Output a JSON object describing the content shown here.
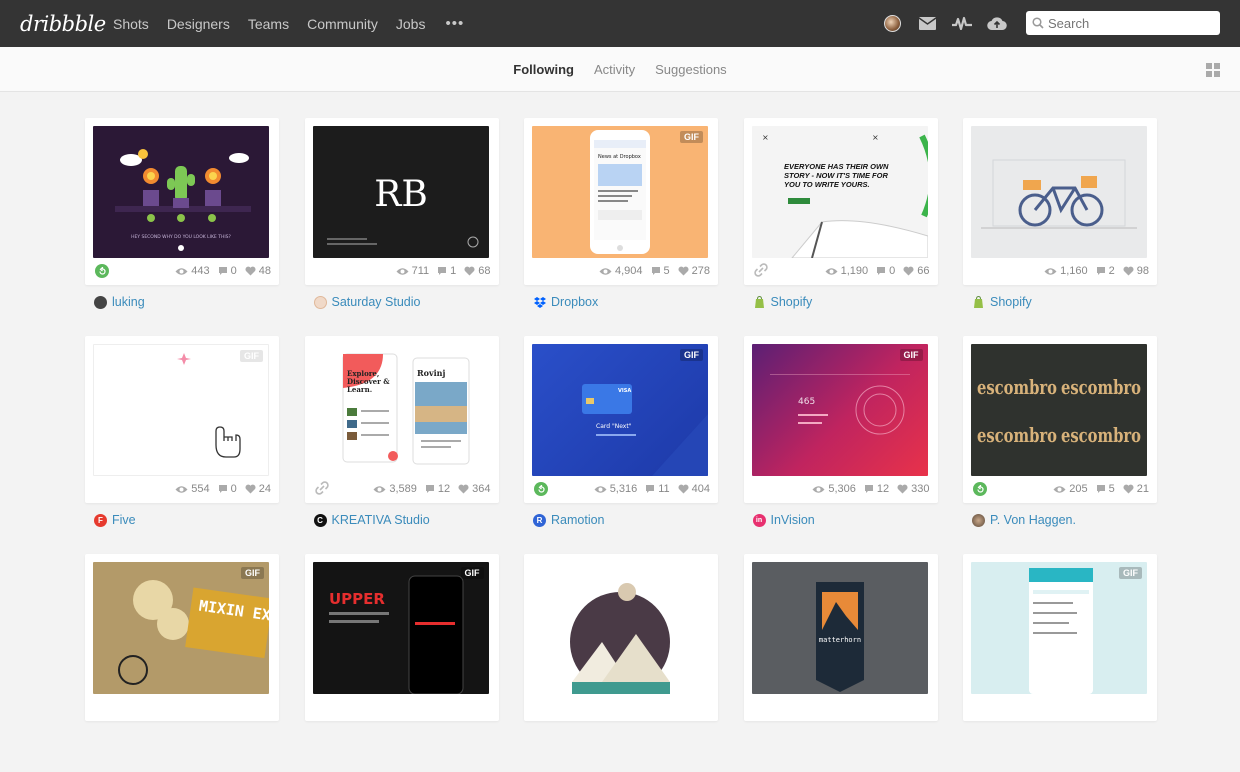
{
  "nav": {
    "logo": "dribbble",
    "links": [
      "Shots",
      "Designers",
      "Teams",
      "Community",
      "Jobs"
    ],
    "more": "•••",
    "search_placeholder": "Search"
  },
  "subnav": {
    "tabs": [
      "Following",
      "Activity",
      "Suggestions"
    ],
    "active": "Following"
  },
  "shots": [
    {
      "owner": "luking",
      "views": "443",
      "comments": "0",
      "likes": "48",
      "gif": false,
      "lead": "rebound",
      "accent": "#2b1836"
    },
    {
      "owner": "Saturday Studio",
      "views": "711",
      "comments": "1",
      "likes": "68",
      "gif": false,
      "lead": "none",
      "accent": "#1c1c1c"
    },
    {
      "owner": "Dropbox",
      "views": "4,904",
      "comments": "5",
      "likes": "278",
      "gif": true,
      "lead": "none",
      "accent": "#f9b473"
    },
    {
      "owner": "Shopify",
      "views": "1,190",
      "comments": "0",
      "likes": "66",
      "gif": false,
      "lead": "attachment",
      "accent": "#f4f4f4"
    },
    {
      "owner": "Shopify",
      "views": "1,160",
      "comments": "2",
      "likes": "98",
      "gif": false,
      "lead": "none",
      "accent": "#e9eaeb"
    },
    {
      "owner": "Five",
      "views": "554",
      "comments": "0",
      "likes": "24",
      "gif": true,
      "lead": "none",
      "accent": "#ffffff"
    },
    {
      "owner": "KREATIVA Studio",
      "views": "3,589",
      "comments": "12",
      "likes": "364",
      "gif": false,
      "lead": "attachment",
      "accent": "#ffffff"
    },
    {
      "owner": "Ramotion",
      "views": "5,316",
      "comments": "11",
      "likes": "404",
      "gif": true,
      "lead": "rebound",
      "accent": "#2a4fc9"
    },
    {
      "owner": "InVision",
      "views": "5,306",
      "comments": "12",
      "likes": "330",
      "gif": true,
      "lead": "none",
      "accent": "#c0245f"
    },
    {
      "owner": "P. Von Haggen.",
      "views": "205",
      "comments": "5",
      "likes": "21",
      "gif": false,
      "lead": "rebound",
      "accent": "#2f322e"
    },
    {
      "owner": "",
      "views": "",
      "comments": "",
      "likes": "",
      "gif": true,
      "lead": "none",
      "accent": "#b39a69"
    },
    {
      "owner": "",
      "views": "",
      "comments": "",
      "likes": "",
      "gif": true,
      "lead": "none",
      "accent": "#141414"
    },
    {
      "owner": "",
      "views": "",
      "comments": "",
      "likes": "",
      "gif": false,
      "lead": "none",
      "accent": "#ffffff"
    },
    {
      "owner": "",
      "views": "",
      "comments": "",
      "likes": "",
      "gif": false,
      "lead": "none",
      "accent": "#5a5d61"
    },
    {
      "owner": "",
      "views": "",
      "comments": "",
      "likes": "",
      "gif": true,
      "lead": "none",
      "accent": "#d8eef0"
    }
  ],
  "thumb_text": {
    "s1_caption": "HEY SECOND WHY DO YOU LOOK LIKE THIS?",
    "s2_mono": "RB",
    "s3_title": "News at Dropbox",
    "s4_headline": "EVERYONE HAS THEIR OWN STORY - NOW IT'S TIME FOR YOU TO WRITE YOURS.",
    "s7_a": "Explore, Discover & Learn.",
    "s7_b": "Rovinj",
    "s8_card": "Card \"Next\"",
    "s8_visa": "VISA",
    "s9_num": "465",
    "s10_word": "escombro",
    "s11_word": "MIXIN EXPE",
    "s12_word": "UPPER",
    "s14_word": "matterhorn"
  },
  "gif_label": "GIF"
}
